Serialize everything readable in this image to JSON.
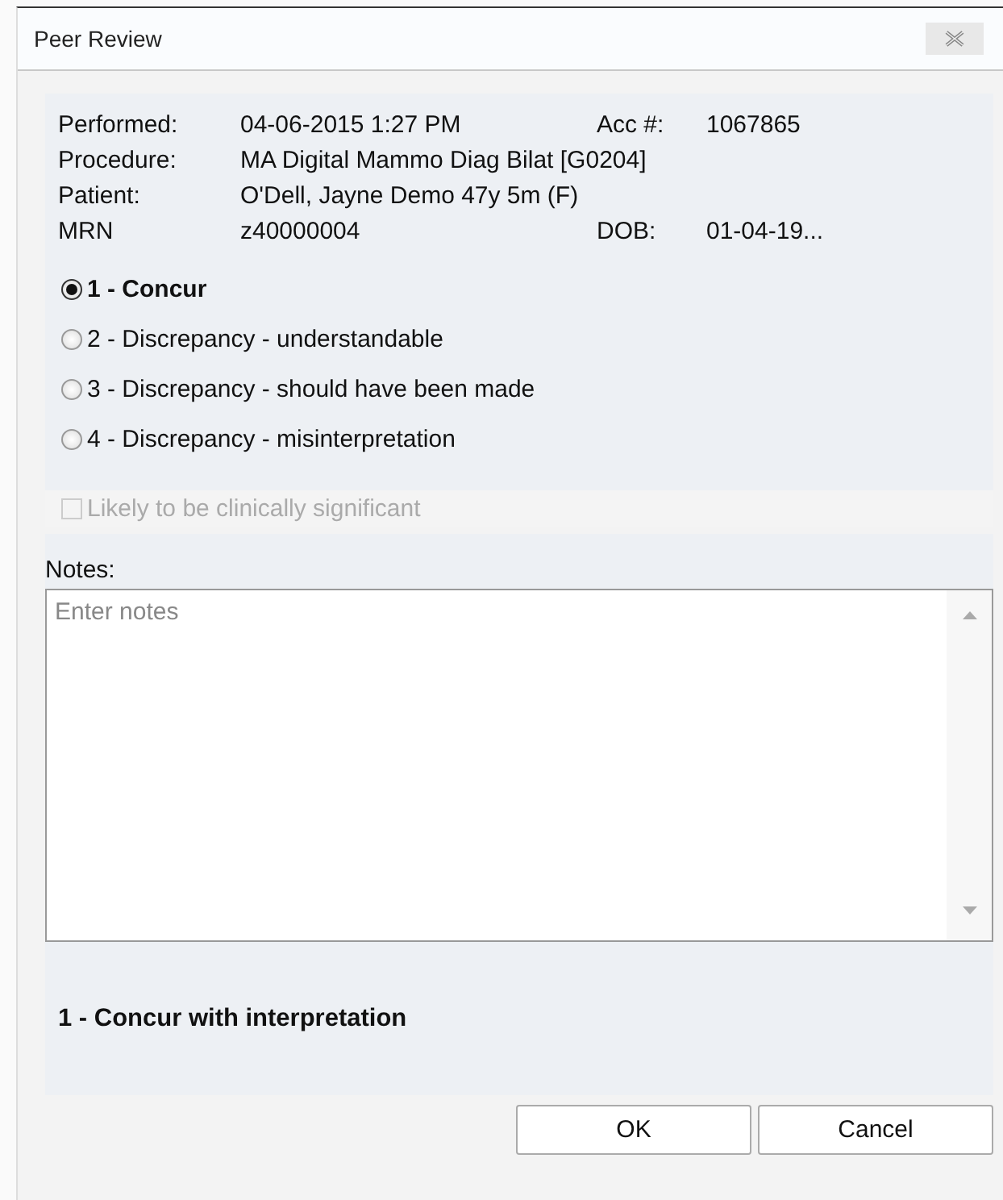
{
  "window": {
    "title": "Peer Review"
  },
  "info": [
    {
      "label": "Performed:",
      "value": "04-06-2015 1:27 PM",
      "label_2": "Acc #:",
      "value_2": "1067865"
    },
    {
      "label": "Procedure:",
      "value": "MA Digital Mammo Diag Bilat [G0204]"
    },
    {
      "label": "Patient:",
      "value": "O'Dell, Jayne Demo 47y 5m  (F)"
    },
    {
      "label": "MRN",
      "value": "z40000004",
      "label_2": "DOB:",
      "value_2": "01-04-19..."
    }
  ],
  "ratings": [
    {
      "label": "1 - Concur",
      "selected": true
    },
    {
      "label": "2 - Discrepancy - understandable",
      "selected": false
    },
    {
      "label": "3 - Discrepancy - should have been made",
      "selected": false
    },
    {
      "label": "4 - Discrepancy - misinterpretation",
      "selected": false
    }
  ],
  "significant": {
    "label": "Likely to be clinically significant",
    "checked": false,
    "disabled": true
  },
  "notes": {
    "label": "Notes:",
    "placeholder": "Enter notes"
  },
  "description": "1 - Concur with interpretation",
  "buttons": [
    "OK",
    "Cancel"
  ]
}
